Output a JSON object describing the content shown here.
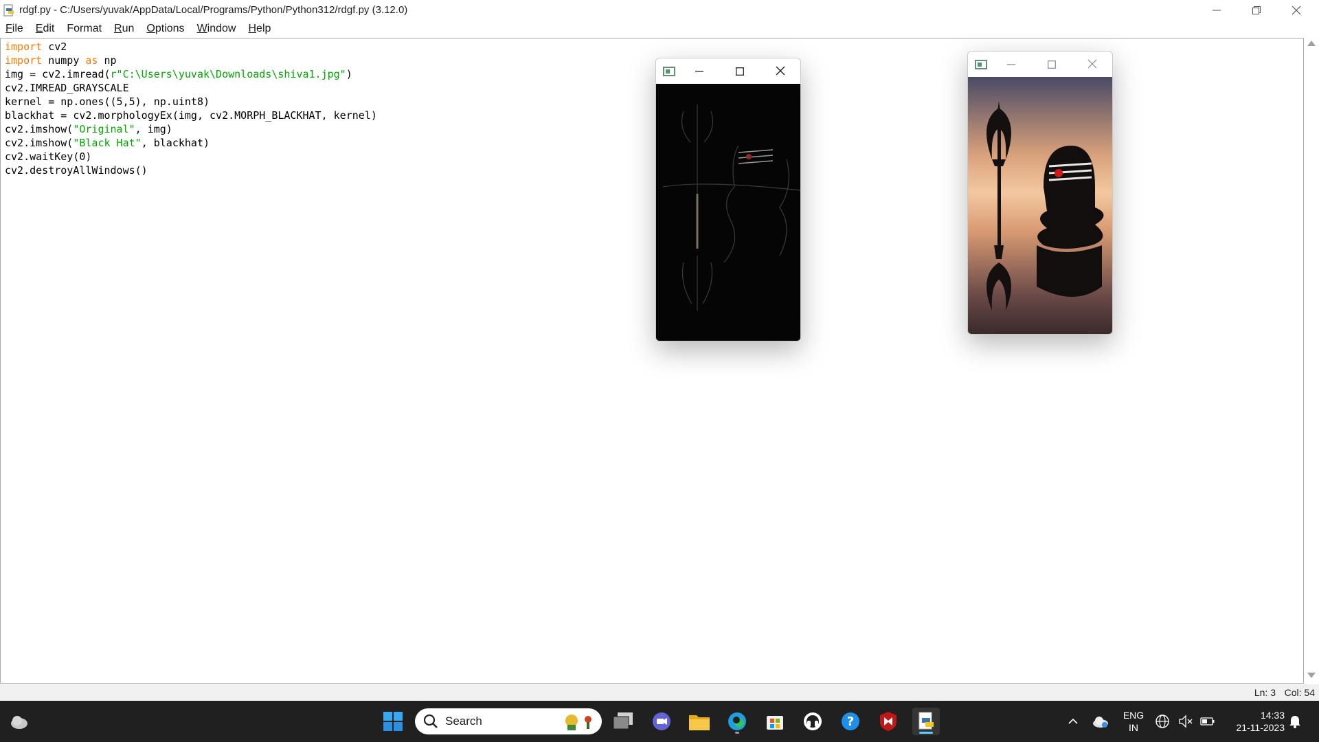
{
  "window": {
    "title": "rdgf.py - C:/Users/yuvak/AppData/Local/Programs/Python/Python312/rdgf.py (3.12.0)"
  },
  "menu": {
    "items": [
      {
        "label": "File",
        "key": "F",
        "rest": "ile"
      },
      {
        "label": "Edit",
        "key": "E",
        "rest": "dit"
      },
      {
        "label": "Format",
        "key": "",
        "rest": "Format"
      },
      {
        "label": "Run",
        "key": "R",
        "rest": "un"
      },
      {
        "label": "Options",
        "key": "O",
        "rest": "ptions"
      },
      {
        "label": "Window",
        "key": "W",
        "rest": "indow"
      },
      {
        "label": "Help",
        "key": "H",
        "rest": "elp"
      }
    ]
  },
  "code": {
    "lines": [
      [
        {
          "t": "import",
          "c": "kw"
        },
        {
          "t": " cv2",
          "c": ""
        }
      ],
      [
        {
          "t": "import",
          "c": "kw"
        },
        {
          "t": " numpy ",
          "c": ""
        },
        {
          "t": "as",
          "c": "kw"
        },
        {
          "t": " np",
          "c": ""
        }
      ],
      [
        {
          "t": "img = cv2.imread(",
          "c": ""
        },
        {
          "t": "r\"C:\\Users\\yuvak\\Downloads\\shiva1.jpg\"",
          "c": "str"
        },
        {
          "t": ")",
          "c": ""
        }
      ],
      [
        {
          "t": "cv2.IMREAD_GRAYSCALE",
          "c": ""
        }
      ],
      [
        {
          "t": "kernel = np.ones((5,5), np.uint8)",
          "c": ""
        }
      ],
      [
        {
          "t": "blackhat = cv2.morphologyEx(img, cv2.MORPH_BLACKHAT, kernel)",
          "c": ""
        }
      ],
      [
        {
          "t": "cv2.imshow(",
          "c": ""
        },
        {
          "t": "\"Original\"",
          "c": "str"
        },
        {
          "t": ", img)",
          "c": ""
        }
      ],
      [
        {
          "t": "cv2.imshow(",
          "c": ""
        },
        {
          "t": "\"Black Hat\"",
          "c": "str"
        },
        {
          "t": ", blackhat)",
          "c": ""
        }
      ],
      [
        {
          "t": "cv2.waitKey(0)",
          "c": ""
        }
      ],
      [
        {
          "t": "cv2.destroyAllWindows()",
          "c": ""
        }
      ]
    ]
  },
  "status": {
    "line": "Ln: 3",
    "col": "Col: 54"
  },
  "taskbar": {
    "search_label": "Search",
    "language": "ENG",
    "region": "IN",
    "time": "14:33",
    "date": "21-11-2023"
  },
  "colors": {
    "keyword": "#ff7700",
    "string": "#00aa00",
    "taskbar_bg": "#202020"
  }
}
